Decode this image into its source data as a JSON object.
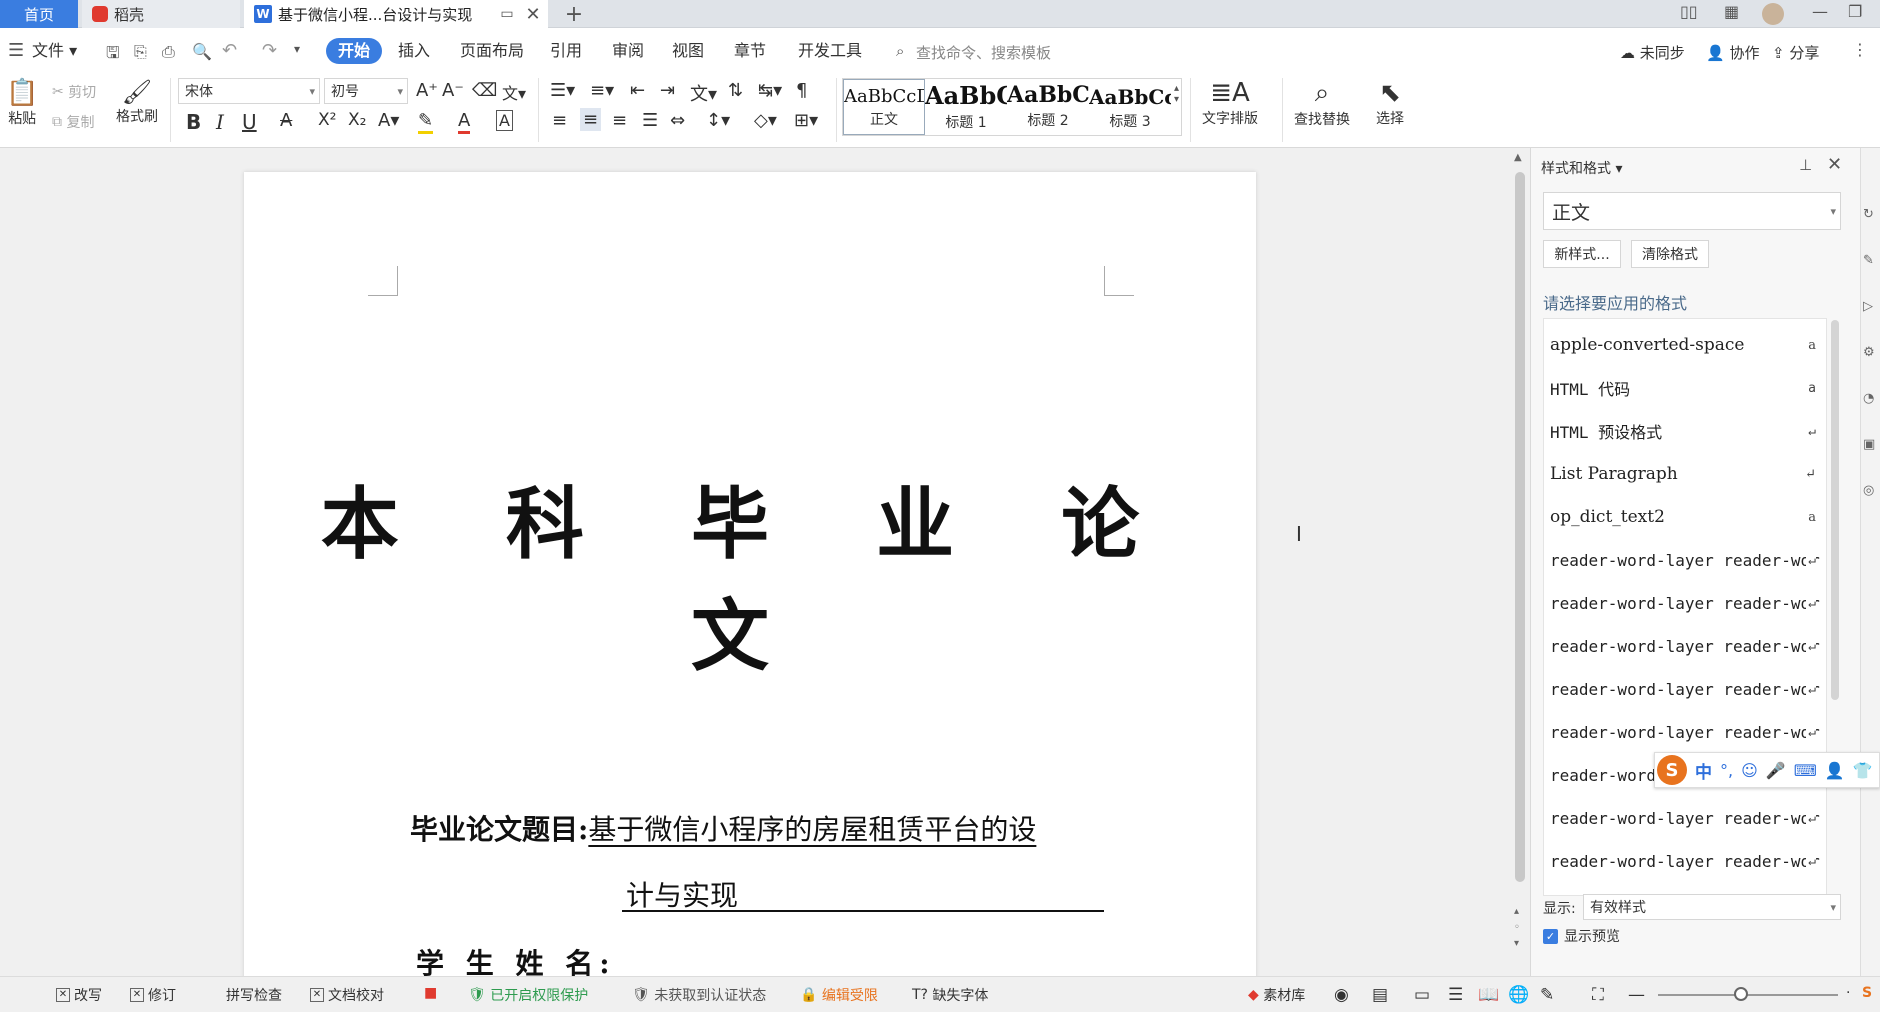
{
  "titlebar": {
    "tabs": [
      {
        "label": "首页"
      },
      {
        "label": "稻壳"
      },
      {
        "label": "基于微信小程...台设计与实现"
      }
    ],
    "add_tab": "+"
  },
  "menubar": {
    "file": "文件",
    "items": [
      "开始",
      "插入",
      "页面布局",
      "引用",
      "审阅",
      "视图",
      "章节",
      "开发工具"
    ],
    "search_placeholder": "查找命令、搜索模板",
    "sync": "未同步",
    "collab": "协作",
    "share": "分享"
  },
  "ribbon": {
    "paste": "粘贴",
    "cut": "剪切",
    "copy": "复制",
    "format_painter": "格式刷",
    "font_name": "宋体",
    "font_size": "初号",
    "styles": [
      {
        "sample": "AaBbCcD",
        "label": "正文"
      },
      {
        "sample": "AaBbC",
        "label": "标题 1"
      },
      {
        "sample": "AaBbC",
        "label": "标题 2"
      },
      {
        "sample": "AaBbCcl",
        "label": "标题 3"
      }
    ],
    "text_layout": "文字排版",
    "find_replace": "查找替换",
    "select": "选择"
  },
  "document": {
    "title": "本 科 毕 业 论 文",
    "topic_label": "毕业论文题目:",
    "topic_line1": "基于微信小程序的房屋租赁平台的设",
    "topic_line2": "计与实现",
    "student_label": "学 生  姓 名:"
  },
  "panel": {
    "title": "样式和格式",
    "current_style": "正文",
    "new_style": "新样式...",
    "clear_format": "清除格式",
    "prompt": "请选择要应用的格式",
    "items": [
      {
        "name": "apple-converted-space",
        "mark": "a"
      },
      {
        "name": "HTML 代码",
        "mark": "a"
      },
      {
        "name": "HTML 预设格式",
        "mark": "↵"
      },
      {
        "name": "List Paragraph",
        "mark": "↵"
      },
      {
        "name": "op_dict_text2",
        "mark": "a"
      },
      {
        "name": "reader-word-layer reader-word-layer",
        "mark": "↵"
      },
      {
        "name": "reader-word-layer reader-word-layer",
        "mark": "↵"
      },
      {
        "name": "reader-word-layer reader-word-layer",
        "mark": "↵"
      },
      {
        "name": "reader-word-layer reader-word-layer",
        "mark": "↵"
      },
      {
        "name": "reader-word-layer reader-word-layer",
        "mark": "↵"
      },
      {
        "name": "reader-word-layer reader-word-layer",
        "mark": "↵"
      },
      {
        "name": "reader-word-layer reader-word-layer",
        "mark": "↵"
      },
      {
        "name": "reader-word-layer reader-word-layer",
        "mark": "↵"
      }
    ],
    "show_label": "显示:",
    "show_value": "有效样式",
    "preview_label": "显示预览"
  },
  "ime": {
    "lang": "中"
  },
  "status": {
    "overwrite": "改写",
    "revise": "修订",
    "spell": "拼写检查",
    "proofread": "文档校对",
    "permission": "已开启权限保护",
    "cert": "未获取到认证状态",
    "edit_restrict": "编辑受限",
    "missing_font": "缺失字体",
    "materials": "素材库"
  },
  "colors": {
    "accent": "#3a7de0",
    "orange": "#e8731e",
    "green": "#2e9b4f",
    "red": "#e03a2f"
  }
}
